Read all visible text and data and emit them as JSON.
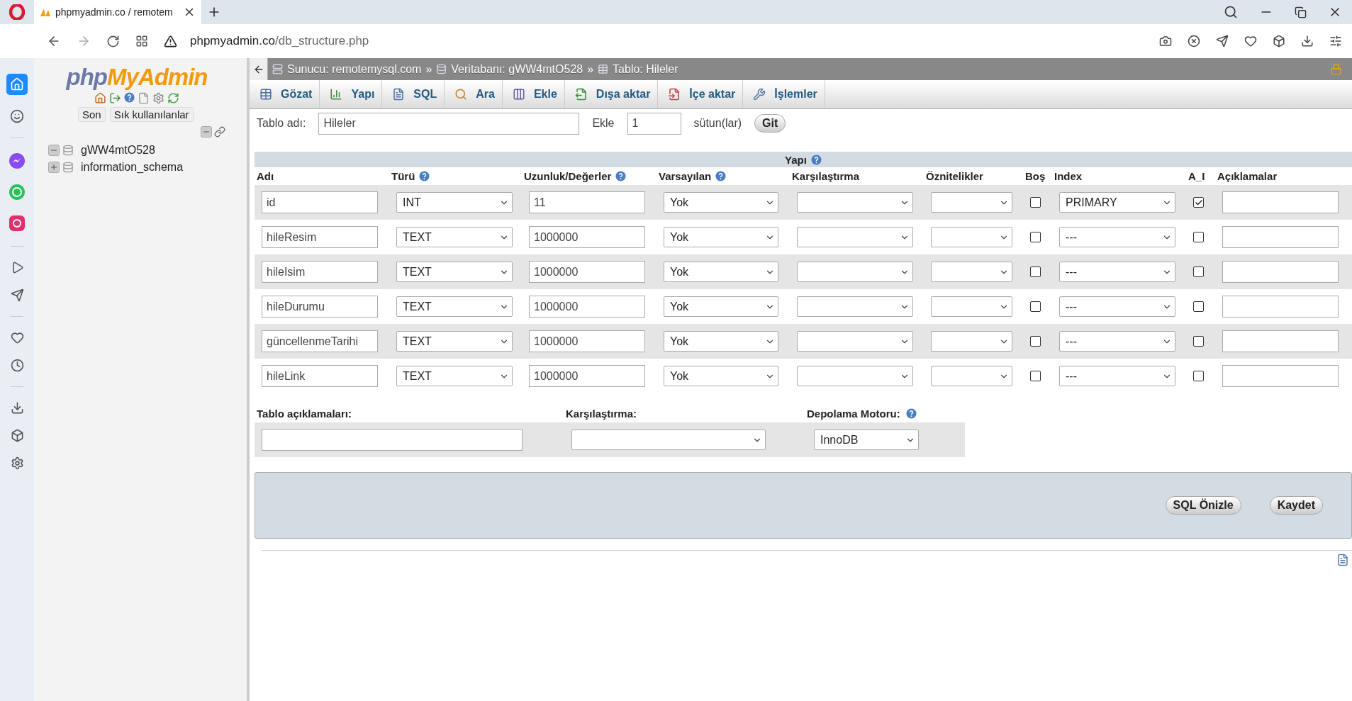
{
  "browser": {
    "tab_title": "phpmyadmin.co / remotem",
    "url_host": "phpmyadmin.co",
    "url_path": "/db_structure.php"
  },
  "navigation": {
    "logo_parts": [
      "php",
      "MyAdmin"
    ],
    "buttons": [
      "Son",
      "Sık kullanılanlar"
    ],
    "tree": [
      {
        "label": "gWW4mtO528",
        "expanded": true
      },
      {
        "label": "information_schema",
        "expanded": false
      }
    ]
  },
  "breadcrumb": {
    "separator": "»",
    "items": [
      {
        "kind": "server",
        "label": "Sunucu: remotemysql.com"
      },
      {
        "kind": "database",
        "label": "Veritabanı: gWW4mtO528"
      },
      {
        "kind": "table",
        "label": "Tablo: Hileler"
      }
    ]
  },
  "tabs": [
    {
      "kind": "browse",
      "label": "Gözat",
      "selected": false
    },
    {
      "kind": "structure",
      "label": "Yapı",
      "selected": false
    },
    {
      "kind": "sql",
      "label": "SQL",
      "selected": false
    },
    {
      "kind": "search",
      "label": "Ara",
      "selected": false
    },
    {
      "kind": "insert",
      "label": "Ekle",
      "selected": false
    },
    {
      "kind": "export",
      "label": "Dışa aktar",
      "selected": false
    },
    {
      "kind": "import",
      "label": "İçe aktar",
      "selected": false
    },
    {
      "kind": "operations",
      "label": "İşlemler",
      "selected": false
    }
  ],
  "table_form": {
    "name_label": "Tablo adı:",
    "name": "Hileler",
    "add_label": "Ekle",
    "add_count": "1",
    "columns_label": "sütun(lar)",
    "go": "Git"
  },
  "structure": {
    "title": "Yapı",
    "headers": [
      {
        "label": "Adı",
        "help": false
      },
      {
        "label": "Türü",
        "help": true
      },
      {
        "label": "Uzunluk/Değerler",
        "help": true
      },
      {
        "label": "Varsayılan",
        "help": true
      },
      {
        "label": "Karşılaştırma",
        "help": false
      },
      {
        "label": "Öznitelikler",
        "help": false
      },
      {
        "label": "Boş",
        "help": false
      },
      {
        "label": "Index",
        "help": false
      },
      {
        "label": "A_I",
        "help": false
      },
      {
        "label": "Açıklamalar",
        "help": false
      }
    ],
    "rows": [
      {
        "name": "id",
        "type": "INT",
        "length": "11",
        "default": "Yok",
        "null": false,
        "index": "PRIMARY",
        "ai": true
      },
      {
        "name": "hileResim",
        "type": "TEXT",
        "length": "1000000",
        "default": "Yok",
        "null": false,
        "index": "---",
        "ai": false
      },
      {
        "name": "hileIsim",
        "type": "TEXT",
        "length": "1000000",
        "default": "Yok",
        "null": false,
        "index": "---",
        "ai": false
      },
      {
        "name": "hileDurumu",
        "type": "TEXT",
        "length": "1000000",
        "default": "Yok",
        "null": false,
        "index": "---",
        "ai": false
      },
      {
        "name": "güncellenmeTarihi",
        "type": "TEXT",
        "length": "1000000",
        "default": "Yok",
        "null": false,
        "index": "---",
        "ai": false
      },
      {
        "name": "hileLink",
        "type": "TEXT",
        "length": "1000000",
        "default": "Yok",
        "null": false,
        "index": "---",
        "ai": false
      }
    ]
  },
  "table_options": {
    "comments_label": "Tablo açıklamaları:",
    "collation_label": "Karşılaştırma:",
    "engine_label": "Depolama Motoru:",
    "engine": "InnoDB"
  },
  "actions": [
    "SQL Önizle",
    "Kaydet"
  ]
}
